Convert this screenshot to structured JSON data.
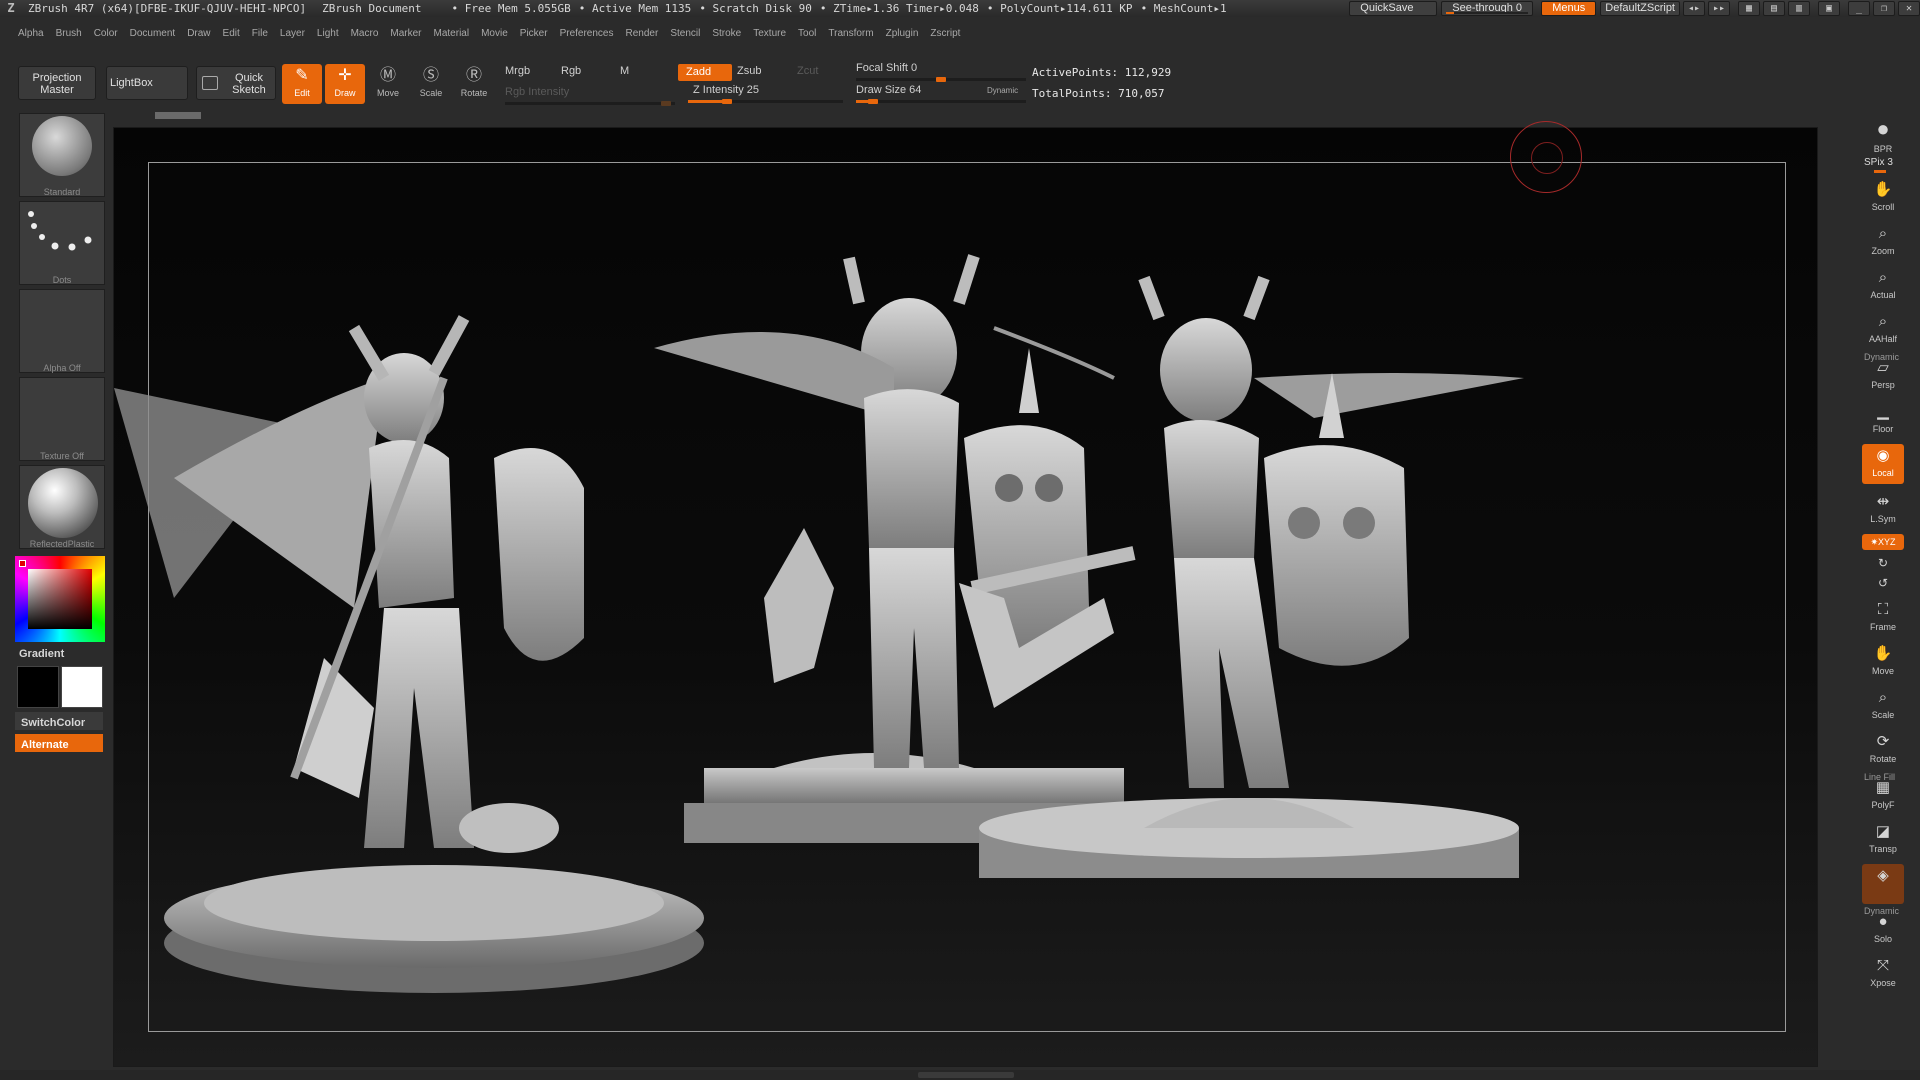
{
  "titlebar": {
    "app": "ZBrush 4R7 (x64)[DFBE-IKUF-QJUV-HEHI-NPCO]",
    "document": "ZBrush Document",
    "free_mem": "• Free Mem 5.055GB",
    "active_mem": "• Active Mem 1135",
    "scratch": "• Scratch Disk 90",
    "ztime": "• ZTime▸1.36 Timer▸0.048",
    "polycount": "• PolyCount▸114.611 KP",
    "meshcount": "• MeshCount▸1",
    "quicksave": "QuickSave",
    "seethrough": "See-through  0",
    "menus": "Menus",
    "script": "DefaultZScript"
  },
  "menubar": [
    "Alpha",
    "Brush",
    "Color",
    "Document",
    "Draw",
    "Edit",
    "File",
    "Layer",
    "Light",
    "Macro",
    "Marker",
    "Material",
    "Movie",
    "Picker",
    "Preferences",
    "Render",
    "Stencil",
    "Stroke",
    "Texture",
    "Tool",
    "Transform",
    "Zplugin",
    "Zscript"
  ],
  "shelf": {
    "projection_master": "Projection Master",
    "lightbox": "LightBox",
    "quick_sketch": "Quick Sketch",
    "edit": "Edit",
    "draw": "Draw",
    "move": "Move",
    "scale": "Scale",
    "rotate": "Rotate",
    "mrgb": "Mrgb",
    "rgb": "Rgb",
    "m": "M",
    "rgb_intensity": "Rgb  Intensity",
    "zadd": "Zadd",
    "zsub": "Zsub",
    "zcut": "Zcut",
    "z_intensity": "Z Intensity 25",
    "focal_shift": "Focal Shift 0",
    "draw_size": "Draw  Size 64",
    "dynamic": "Dynamic",
    "active_points": "ActivePoints: 112,929",
    "total_points": "TotalPoints: 710,057",
    "z_intensity_level": 0.25,
    "draw_size_level": 0.1,
    "focal_shift_level": 0.5
  },
  "left": {
    "brush": "Standard",
    "stroke": "Dots",
    "alpha": "Alpha  Off",
    "texture": "Texture  Off",
    "material": "ReflectedPlastic",
    "gradient": "Gradient",
    "switch_color": "SwitchColor",
    "alternate": "Alternate"
  },
  "right": {
    "bpr": "BPR",
    "spix": "SPix 3",
    "scroll": "Scroll",
    "zoom": "Zoom",
    "actual": "Actual",
    "aahalf": "AAHalf",
    "dynamic": "Dynamic",
    "persp": "Persp",
    "floor": "Floor",
    "local": "Local",
    "lsym": "L.Sym",
    "xyz": "✷XYZ",
    "frame": "Frame",
    "move": "Move",
    "scale": "Scale",
    "rotate": "Rotate",
    "linefill": "Line Fill",
    "polyf": "PolyF",
    "transp": "Transp",
    "dynamic2": "Dynamic",
    "solo": "Solo",
    "xpose": "Xpose"
  },
  "colors": {
    "accent": "#e8670c",
    "background": "#2b2b2b",
    "canvas": "#0a0a0a"
  }
}
